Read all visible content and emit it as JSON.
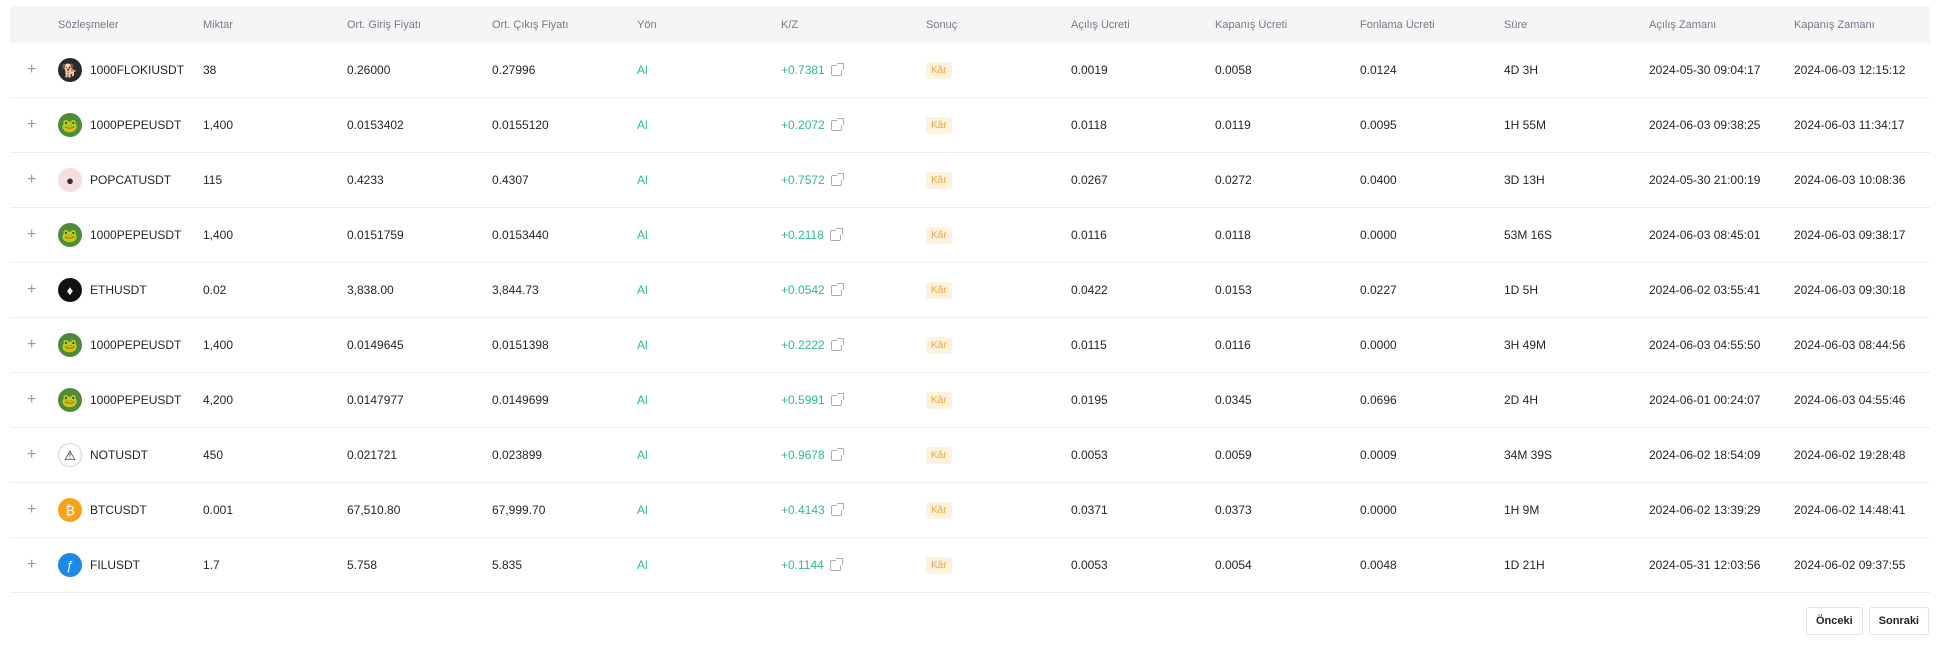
{
  "headers": {
    "contracts": "Sözleşmeler",
    "quantity": "Miktar",
    "avg_entry": "Ort. Giriş Fiyatı",
    "avg_exit": "Ort. Çıkış Fiyatı",
    "direction": "Yön",
    "pnl": "K/Z",
    "result": "Sonuç",
    "open_fee": "Açılış Ücreti",
    "close_fee": "Kapanış Ücreti",
    "funding_fee": "Fonlama Ücreti",
    "duration": "Süre",
    "open_time": "Açılış Zamanı",
    "close_time": "Kapanış Zamanı"
  },
  "expand_symbol": "+",
  "rows": [
    {
      "symbol": "1000FLOKIUSDT",
      "icon": "floki-coin-icon",
      "qty": "38",
      "entry": "0.26000",
      "exit": "0.27996",
      "dir": "Al",
      "pnl": "+0.7381",
      "result": "Kâr",
      "open_fee": "0.0019",
      "close_fee": "0.0058",
      "funding": "0.0124",
      "duration": "4D 3H",
      "open_time": "2024-05-30 09:04:17",
      "close_time": "2024-06-03 12:15:12"
    },
    {
      "symbol": "1000PEPEUSDT",
      "icon": "pepe-coin-icon",
      "qty": "1,400",
      "entry": "0.0153402",
      "exit": "0.0155120",
      "dir": "Al",
      "pnl": "+0.2072",
      "result": "Kâr",
      "open_fee": "0.0118",
      "close_fee": "0.0119",
      "funding": "0.0095",
      "duration": "1H 55M",
      "open_time": "2024-06-03 09:38:25",
      "close_time": "2024-06-03 11:34:17"
    },
    {
      "symbol": "POPCATUSDT",
      "icon": "popcat-coin-icon",
      "qty": "115",
      "entry": "0.4233",
      "exit": "0.4307",
      "dir": "Al",
      "pnl": "+0.7572",
      "result": "Kâr",
      "open_fee": "0.0267",
      "close_fee": "0.0272",
      "funding": "0.0400",
      "duration": "3D 13H",
      "open_time": "2024-05-30 21:00:19",
      "close_time": "2024-06-03 10:08:36"
    },
    {
      "symbol": "1000PEPEUSDT",
      "icon": "pepe-coin-icon",
      "qty": "1,400",
      "entry": "0.0151759",
      "exit": "0.0153440",
      "dir": "Al",
      "pnl": "+0.2118",
      "result": "Kâr",
      "open_fee": "0.0116",
      "close_fee": "0.0118",
      "funding": "0.0000",
      "duration": "53M 16S",
      "open_time": "2024-06-03 08:45:01",
      "close_time": "2024-06-03 09:38:17"
    },
    {
      "symbol": "ETHUSDT",
      "icon": "eth-coin-icon",
      "qty": "0.02",
      "entry": "3,838.00",
      "exit": "3,844.73",
      "dir": "Al",
      "pnl": "+0.0542",
      "result": "Kâr",
      "open_fee": "0.0422",
      "close_fee": "0.0153",
      "funding": "0.0227",
      "duration": "1D 5H",
      "open_time": "2024-06-02 03:55:41",
      "close_time": "2024-06-03 09:30:18"
    },
    {
      "symbol": "1000PEPEUSDT",
      "icon": "pepe-coin-icon",
      "qty": "1,400",
      "entry": "0.0149645",
      "exit": "0.0151398",
      "dir": "Al",
      "pnl": "+0.2222",
      "result": "Kâr",
      "open_fee": "0.0115",
      "close_fee": "0.0116",
      "funding": "0.0000",
      "duration": "3H 49M",
      "open_time": "2024-06-03 04:55:50",
      "close_time": "2024-06-03 08:44:56"
    },
    {
      "symbol": "1000PEPEUSDT",
      "icon": "pepe-coin-icon",
      "qty": "4,200",
      "entry": "0.0147977",
      "exit": "0.0149699",
      "dir": "Al",
      "pnl": "+0.5991",
      "result": "Kâr",
      "open_fee": "0.0195",
      "close_fee": "0.0345",
      "funding": "0.0696",
      "duration": "2D 4H",
      "open_time": "2024-06-01 00:24:07",
      "close_time": "2024-06-03 04:55:46"
    },
    {
      "symbol": "NOTUSDT",
      "icon": "not-coin-icon",
      "qty": "450",
      "entry": "0.021721",
      "exit": "0.023899",
      "dir": "Al",
      "pnl": "+0.9678",
      "result": "Kâr",
      "open_fee": "0.0053",
      "close_fee": "0.0059",
      "funding": "0.0009",
      "duration": "34M 39S",
      "open_time": "2024-06-02 18:54:09",
      "close_time": "2024-06-02 19:28:48"
    },
    {
      "symbol": "BTCUSDT",
      "icon": "btc-coin-icon",
      "qty": "0.001",
      "entry": "67,510.80",
      "exit": "67,999.70",
      "dir": "Al",
      "pnl": "+0.4143",
      "result": "Kâr",
      "open_fee": "0.0371",
      "close_fee": "0.0373",
      "funding": "0.0000",
      "duration": "1H 9M",
      "open_time": "2024-06-02 13:39:29",
      "close_time": "2024-06-02 14:48:41"
    },
    {
      "symbol": "FILUSDT",
      "icon": "fil-coin-icon",
      "qty": "1.7",
      "entry": "5.758",
      "exit": "5.835",
      "dir": "Al",
      "pnl": "+0.1144",
      "result": "Kâr",
      "open_fee": "0.0053",
      "close_fee": "0.0054",
      "funding": "0.0048",
      "duration": "1D 21H",
      "open_time": "2024-05-31 12:03:56",
      "close_time": "2024-06-02 09:37:55"
    }
  ],
  "pagination": {
    "prev": "Önceki",
    "next": "Sonraki"
  },
  "colors": {
    "profit_green": "#2ebd85",
    "badge_bg": "#fdf1e0",
    "badge_text": "#f0a533"
  }
}
